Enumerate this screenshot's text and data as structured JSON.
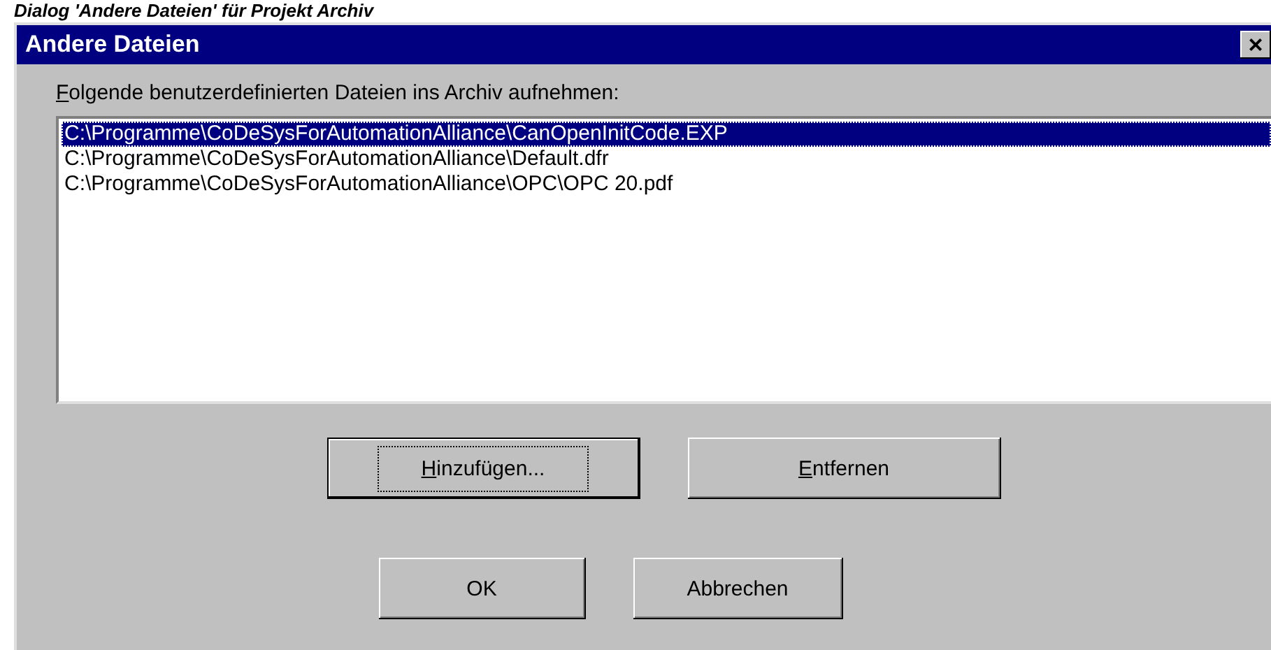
{
  "caption": "Dialog 'Andere Dateien' für Projekt Archiv",
  "window": {
    "title": "Andere Dateien",
    "close": "×"
  },
  "prompt": {
    "label": "Folgende benutzerdefinierten Dateien ins Archiv aufnehmen:",
    "mnemonic": true
  },
  "files": [
    {
      "path": "C:\\Programme\\CoDeSysForAutomationAlliance\\CanOpenInitCode.EXP",
      "selected": true
    },
    {
      "path": "C:\\Programme\\CoDeSysForAutomationAlliance\\Default.dfr",
      "selected": false
    },
    {
      "path": "C:\\Programme\\CoDeSysForAutomationAlliance\\OPC\\OPC 20.pdf",
      "selected": false
    }
  ],
  "buttons": [
    {
      "label": "Hinzufügen...",
      "mnemonic": true,
      "default": true
    },
    {
      "label": "Entfernen",
      "mnemonic": true,
      "default": false
    },
    {
      "label": "OK",
      "mnemonic": false,
      "default": false
    },
    {
      "label": "Abbrechen",
      "mnemonic": false,
      "default": false
    }
  ]
}
